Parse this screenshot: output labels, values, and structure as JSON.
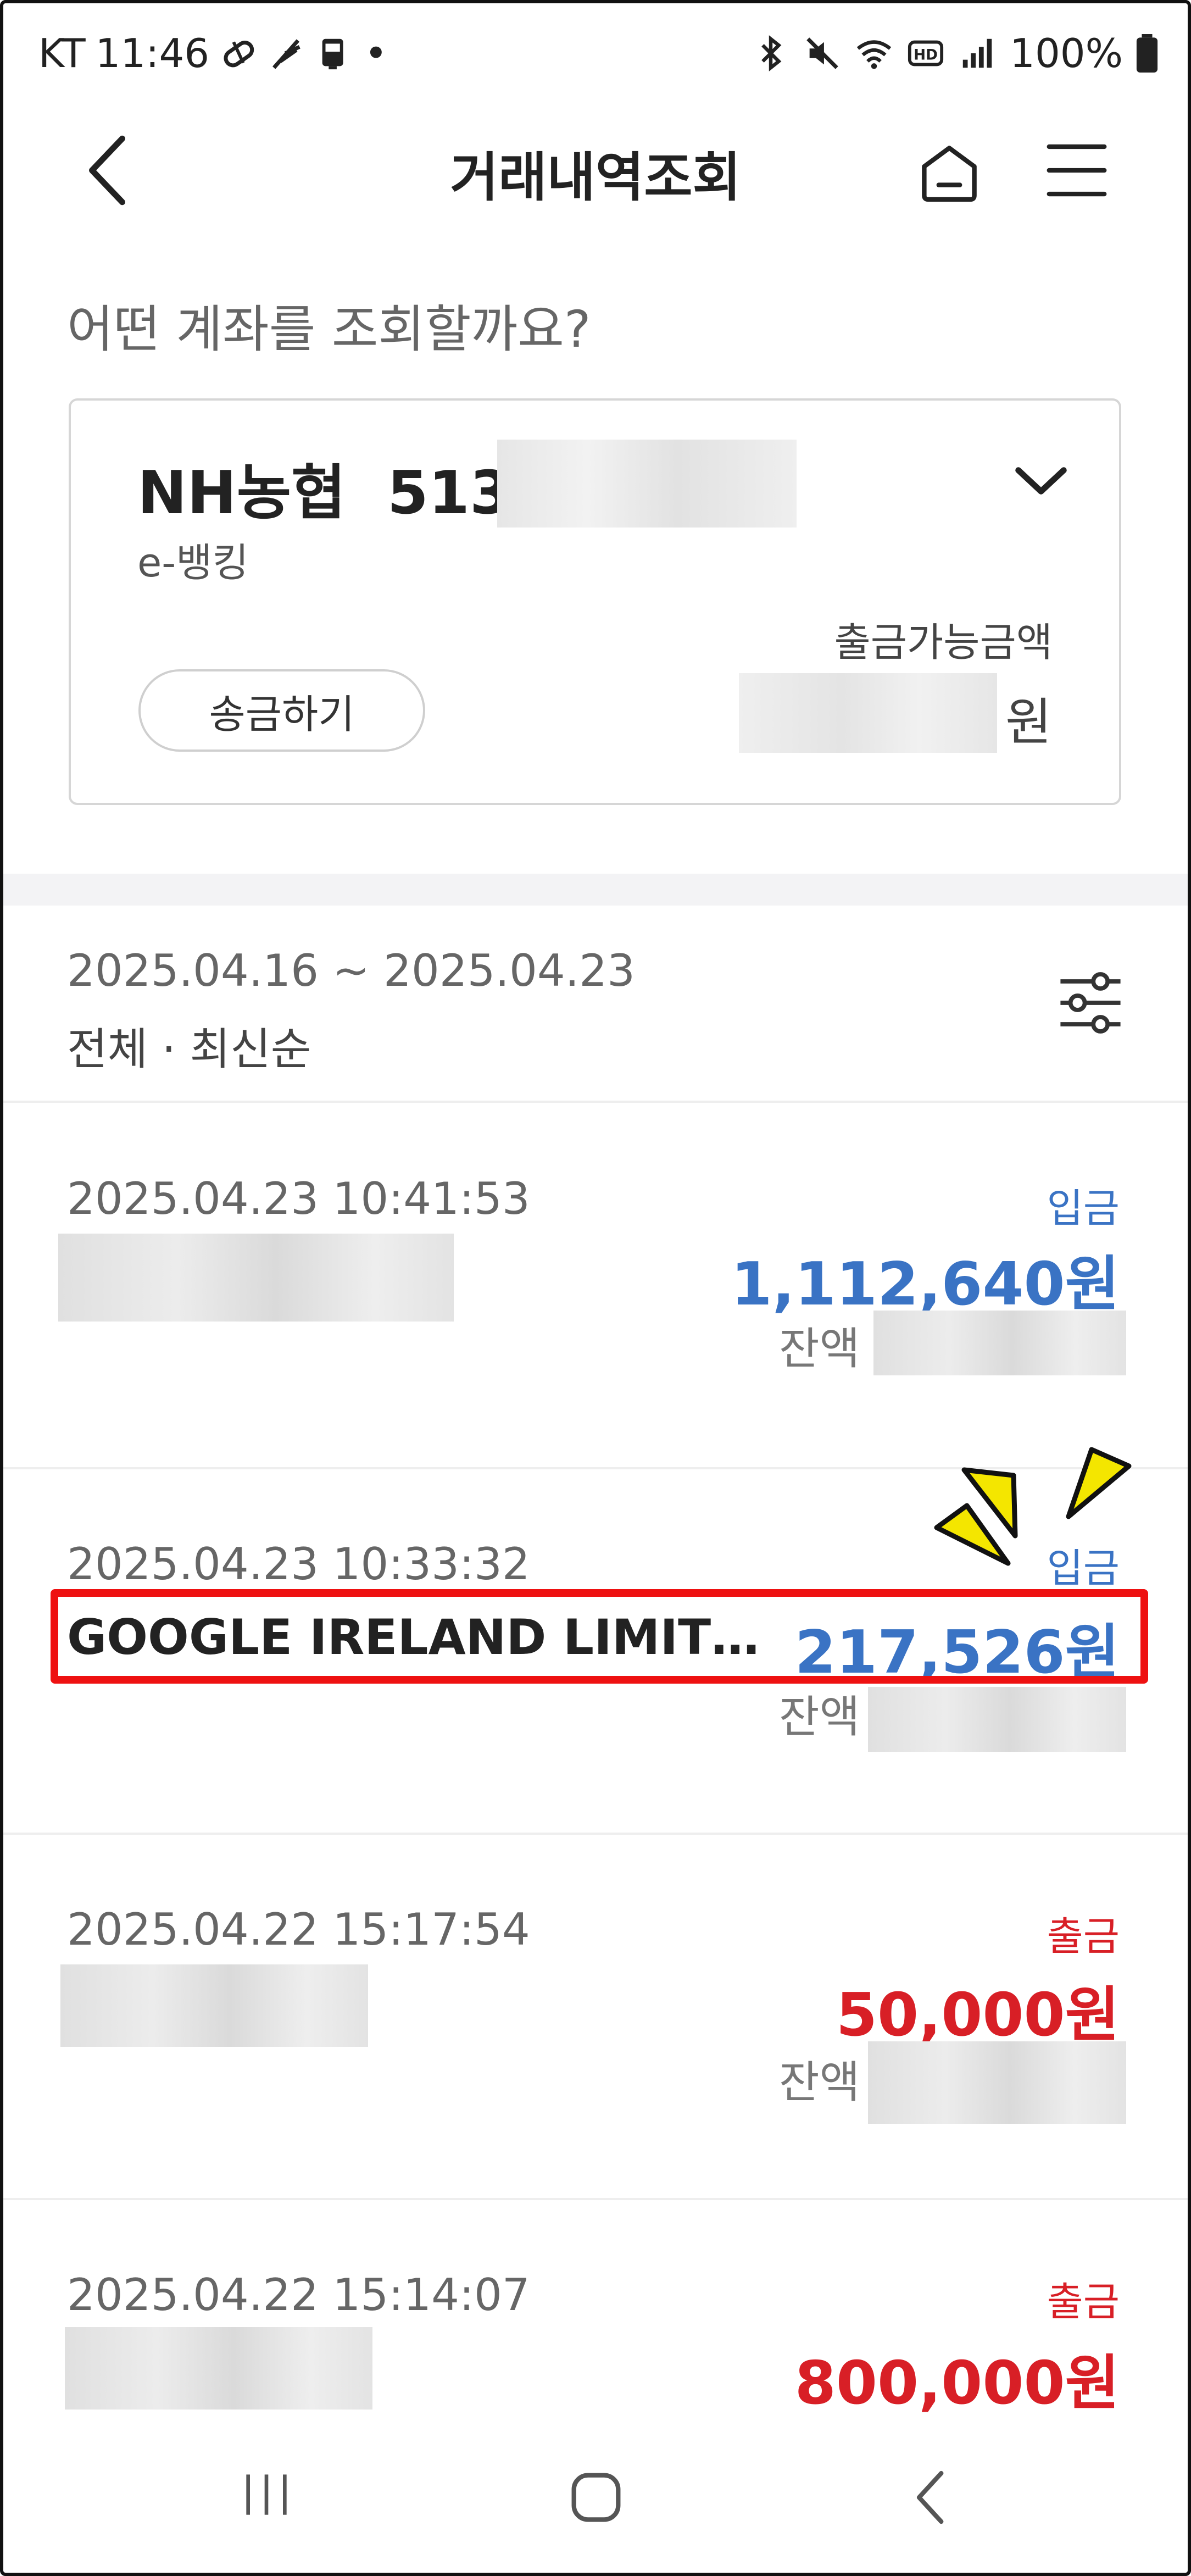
{
  "status_bar": {
    "carrier": "KT",
    "time": "11:46",
    "dot": "•",
    "battery": "100%"
  },
  "header": {
    "title": "거래내역조회"
  },
  "question": "어떤 계좌를 조회할까요?",
  "account": {
    "bank": "NH농협",
    "number_prefix": "513-",
    "type": "e-뱅킹",
    "available_label": "출금가능금액",
    "currency": "원",
    "send_button": "송금하기"
  },
  "filter": {
    "range": "2025.04.16 ~ 2025.04.23",
    "summary": "전체 · 최신순"
  },
  "transactions": [
    {
      "datetime": "2025.04.23 10:41:53",
      "type": "입금",
      "amount": "1,112,640원",
      "balance_label": "잔액"
    },
    {
      "datetime": "2025.04.23 10:33:32",
      "description": "GOOGLE IRELAND LIMIT…",
      "type": "입금",
      "amount": "217,526원",
      "balance_label": "잔액"
    },
    {
      "datetime": "2025.04.22 15:17:54",
      "type": "출금",
      "amount": "50,000원",
      "balance_label": "잔액"
    },
    {
      "datetime": "2025.04.22 15:14:07",
      "type": "출금",
      "amount": "800,000원"
    }
  ],
  "colors": {
    "deposit": "#3a73c4",
    "withdrawal": "#d81f26",
    "highlight": "#ee1111",
    "sparkle": "#f4e600"
  }
}
